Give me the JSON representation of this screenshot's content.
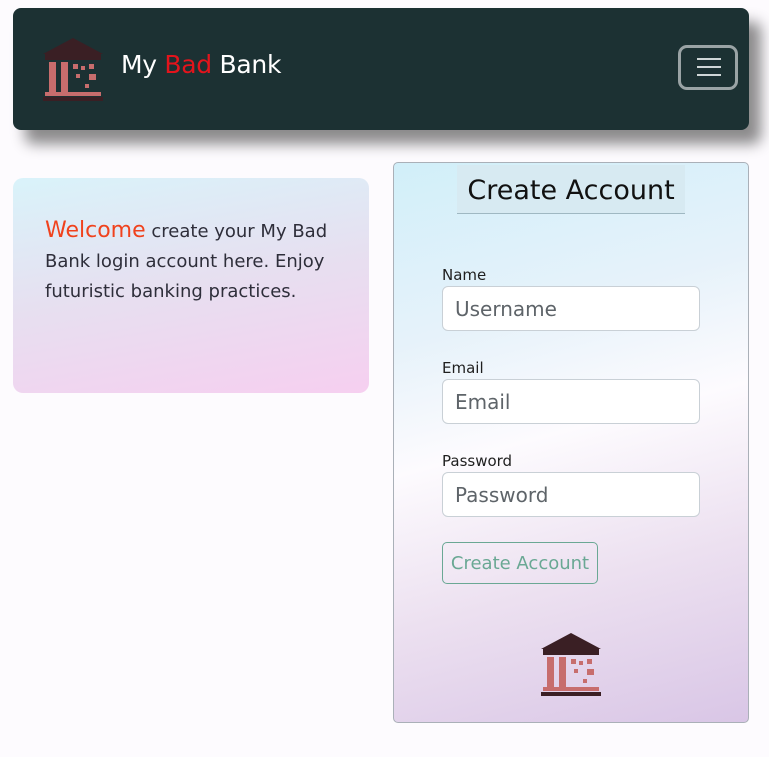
{
  "navbar": {
    "brand_prefix": "My",
    "brand_highlight": "Bad",
    "brand_suffix": "Bank",
    "logo_icon": "bank-building-icon",
    "toggler_icon": "hamburger-menu-icon",
    "bg_color": "#1c3133",
    "highlight_color": "#e3141c"
  },
  "welcome": {
    "highlight": "Welcome",
    "text": "create your My Bad Bank login account here. Enjoy futuristic banking practices.",
    "highlight_color": "#f0421d"
  },
  "form": {
    "title": "Create Account",
    "fields": [
      {
        "label": "Name",
        "placeholder": "Username",
        "value": ""
      },
      {
        "label": "Email",
        "placeholder": "Email",
        "value": ""
      },
      {
        "label": "Password",
        "placeholder": "Password",
        "value": ""
      }
    ],
    "submit_label": "Create Account",
    "footer_icon": "bank-building-icon",
    "button_color": "#6aa894"
  }
}
